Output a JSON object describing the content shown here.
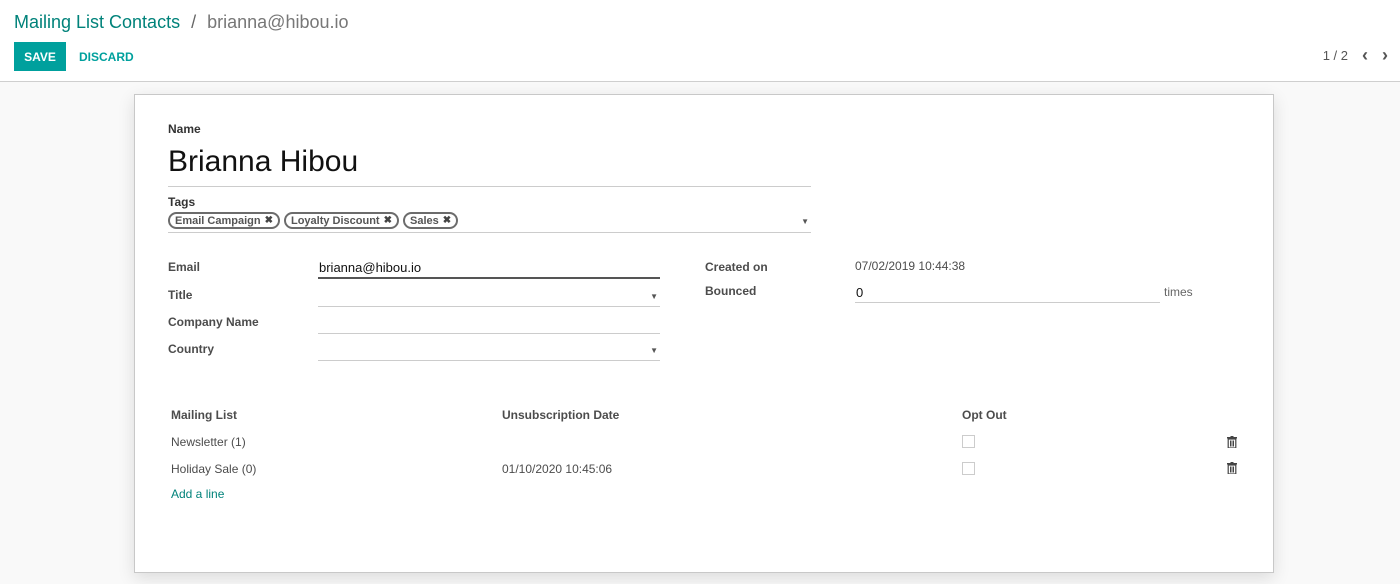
{
  "breadcrumb": {
    "parent": "Mailing List Contacts",
    "separator": "/",
    "current": "brianna@hibou.io"
  },
  "toolbar": {
    "save_label": "SAVE",
    "discard_label": "DISCARD"
  },
  "pager": {
    "value": "1 / 2",
    "prev_icon": "chevron-left-icon",
    "next_icon": "chevron-right-icon"
  },
  "form": {
    "name_label": "Name",
    "name_value": "Brianna Hibou",
    "tags_label": "Tags",
    "tags": [
      {
        "label": "Email Campaign"
      },
      {
        "label": "Loyalty Discount"
      },
      {
        "label": "Sales"
      }
    ],
    "email_label": "Email",
    "email_value": "brianna@hibou.io",
    "title_label": "Title",
    "title_value": "",
    "company_label": "Company Name",
    "company_value": "",
    "country_label": "Country",
    "country_value": "",
    "created_label": "Created on",
    "created_value": "07/02/2019 10:44:38",
    "bounced_label": "Bounced",
    "bounced_value": "0",
    "bounced_unit": "times"
  },
  "subscriptions": {
    "columns": [
      "Mailing List",
      "Unsubscription Date",
      "Opt Out"
    ],
    "rows": [
      {
        "list": "Newsletter (1)",
        "date": "",
        "opt_out": false
      },
      {
        "list": "Holiday Sale (0)",
        "date": "01/10/2020 10:45:06",
        "opt_out": false
      }
    ],
    "add_line": "Add a line"
  },
  "colors": {
    "primary": "#00a09d",
    "link": "#00827a"
  }
}
